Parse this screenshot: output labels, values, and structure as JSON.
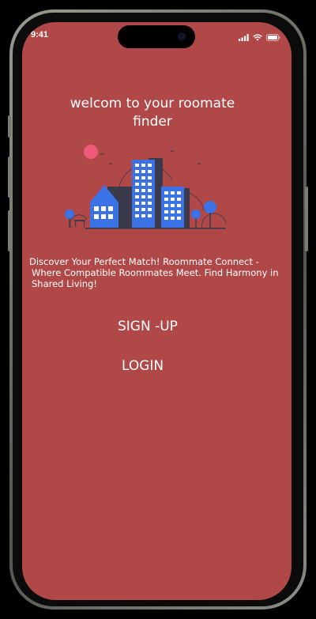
{
  "status_bar": {
    "time": "9:41",
    "icons": [
      "cellular-signal-icon",
      "wifi-icon",
      "battery-icon"
    ]
  },
  "welcome": {
    "title_line1": "welcom to your roomate",
    "title_line2": "finder"
  },
  "illustration": {
    "name": "city-buildings-illustration",
    "colors": {
      "building_blue": "#3b72e6",
      "building_dark": "#3a3a4a",
      "sun": "#f05a7a",
      "window": "#ffffff"
    }
  },
  "description": {
    "line1": "Discover Your Perfect Match! Roommate Connect -",
    "line2": "Where Compatible Roommates Meet. Find Harmony in",
    "line3": "Shared Living!"
  },
  "actions": {
    "signup_label": "SIGN -UP",
    "login_label": "LOGIN"
  },
  "theme": {
    "background": "#b04848",
    "text": "#ffffff"
  }
}
